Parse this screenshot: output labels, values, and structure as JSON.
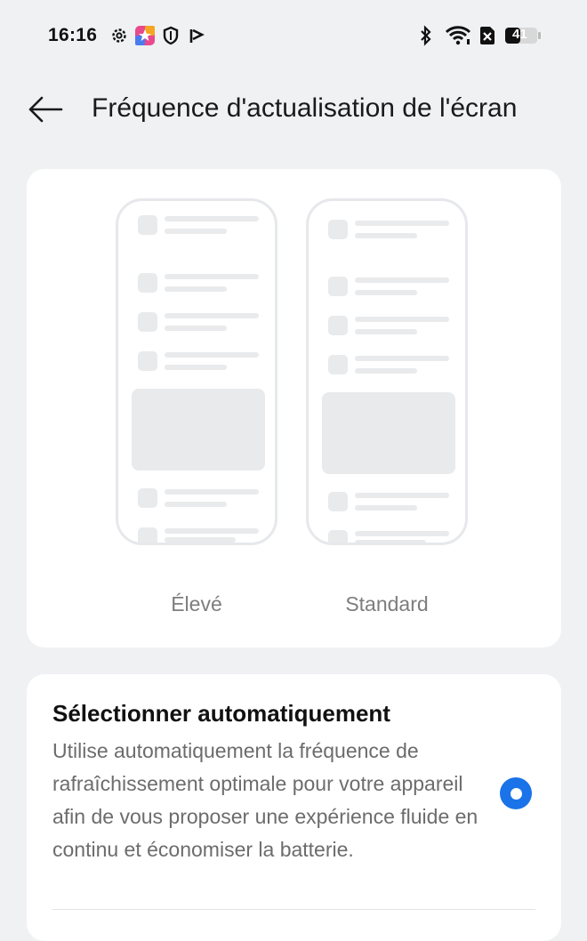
{
  "status_bar": {
    "time": "16:16",
    "battery_level": "41",
    "left_icons": [
      "settings-gear-icon",
      "app-star-icon",
      "shield-icon",
      "play-flag-icon"
    ],
    "right_icons": [
      "bluetooth-icon",
      "wifi-icon",
      "no-sim-icon",
      "battery-icon"
    ]
  },
  "header": {
    "back_icon": "arrow-left-icon",
    "title": "Fréquence d'actualisation de l'écran"
  },
  "preview": {
    "modes": [
      {
        "label": "Élevé"
      },
      {
        "label": "Standard"
      }
    ]
  },
  "auto_option": {
    "title": "Sélectionner automatiquement",
    "description": "Utilise automatiquement la fréquence de rafraîchissement optimale pour votre appareil afin de vous proposer une expérience fluide en continu et économiser la batterie.",
    "selected": true,
    "accent_color": "#1a73e8"
  }
}
